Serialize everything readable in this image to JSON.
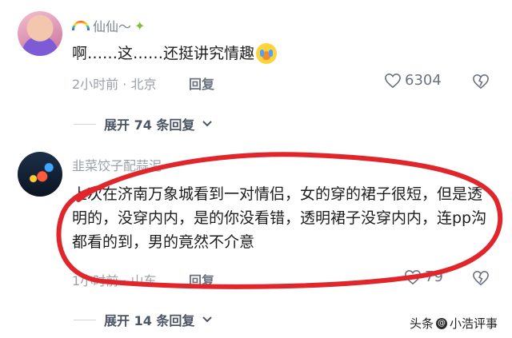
{
  "comment1": {
    "username": "仙仙～",
    "text": "啊……这……还挺讲究情趣",
    "time_location": "2小时前 · 北京",
    "reply_label": "回复",
    "likes": "6304",
    "expand_label": "展开 74 条回复"
  },
  "comment2": {
    "username": "韭菜饺子配蒜泥",
    "text": "上次在济南万象城看到一对情侣，女的穿的裙子很短，但是透明的，没穿内内，是的你没看错，透明裙子没穿内内，连pp沟都看的到，男的竟然不介意",
    "time_location": "1小时前 · 山东",
    "reply_label": "回复",
    "likes": "79",
    "expand_label": "展开 14 条回复"
  },
  "watermark": {
    "prefix": "头条",
    "handle": "小浩评事"
  },
  "colors": {
    "highlight": "#e0262b",
    "meta": "#9aa0aa"
  },
  "icons": [
    "rainbow-icon",
    "fairy-icon",
    "crying-face-emoji",
    "heart-icon",
    "broken-heart-icon",
    "chevron-down-icon",
    "at-icon"
  ]
}
